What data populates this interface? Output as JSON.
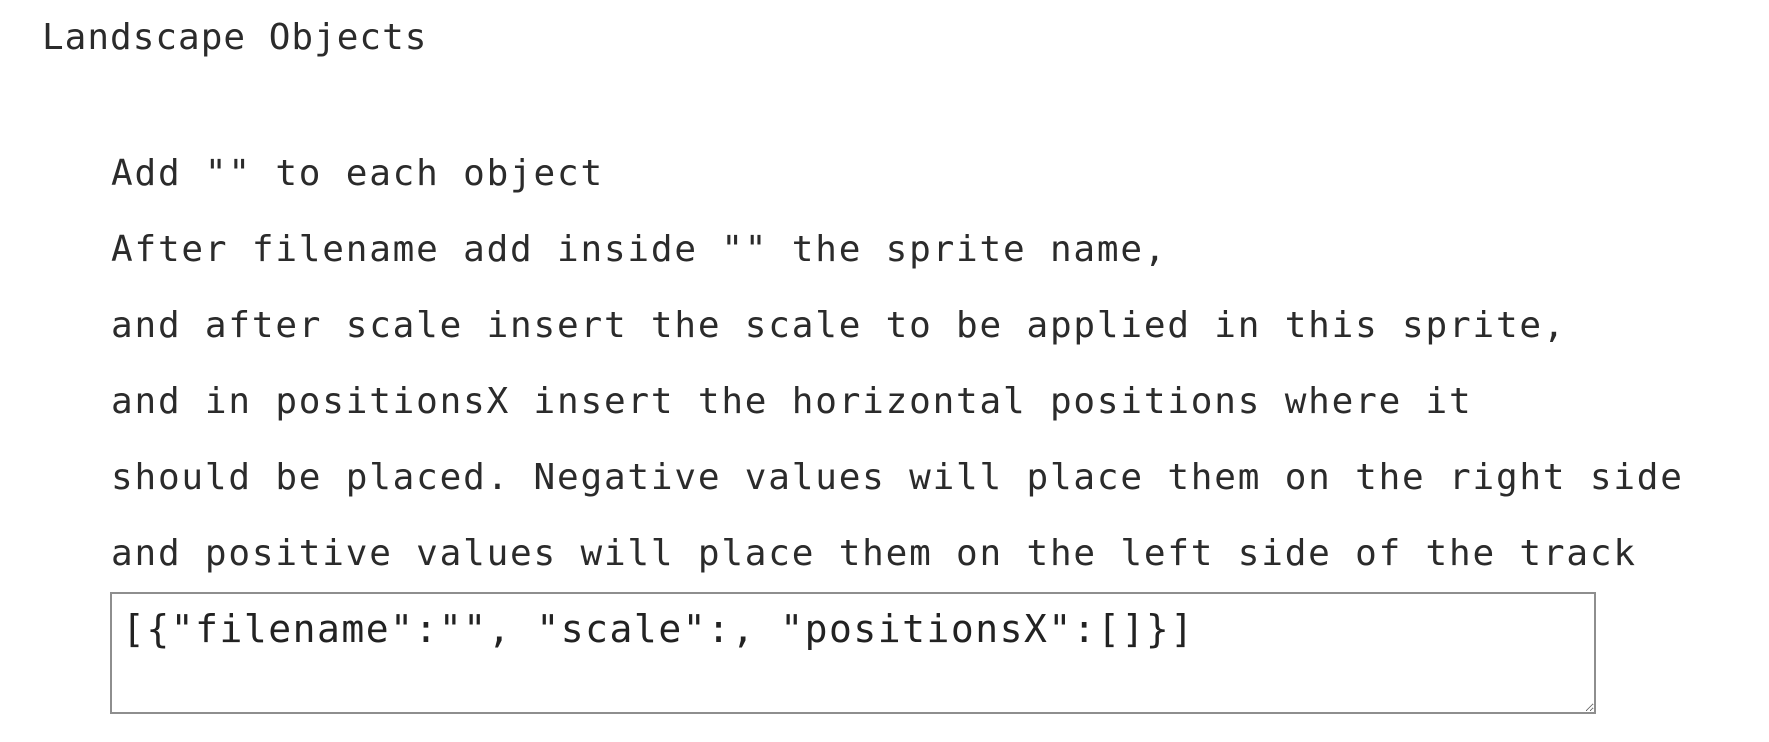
{
  "section": {
    "title": "Landscape Objects"
  },
  "instructions": {
    "lines": [
      "Add \"\" to each object",
      "After filename add inside \"\" the sprite name,",
      "and after scale insert the scale to be applied in this sprite,",
      "and in positionsX insert the horizontal positions where it",
      "should be placed. Negative values will place them on the right side",
      "and positive values will place them on the left side of the track"
    ]
  },
  "editor": {
    "value": "[{\"filename\":\"\", \"scale\":, \"positionsX\":[]}]"
  }
}
